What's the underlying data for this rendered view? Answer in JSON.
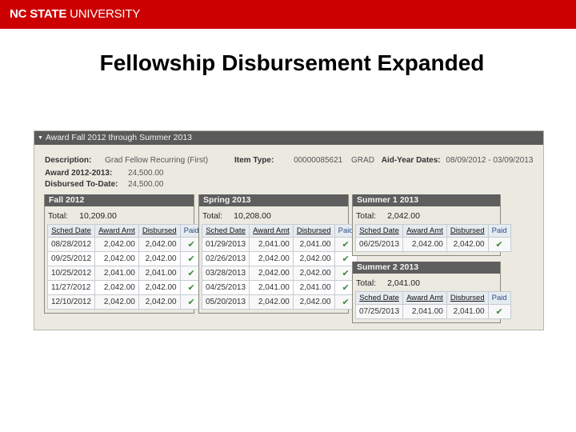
{
  "brand": {
    "bold": "NC STATE",
    "light": " UNIVERSITY",
    "color": "#cc0000"
  },
  "slide_title": "Fellowship Disbursement Expanded",
  "award": {
    "header": "Award Fall 2012 through Summer 2013",
    "description_label": "Description:",
    "description_value": "Grad Fellow Recurring (First)",
    "item_type_label": "Item Type:",
    "item_type_value": "00000085621",
    "item_type_code": "GRAD",
    "aid_year_label": "Aid-Year Dates:",
    "aid_year_value": "08/09/2012 - 03/09/2013",
    "award_label": "Award 2012-2013:",
    "award_value": "24,500.00",
    "disbursed_label": "Disbursed To-Date:",
    "disbursed_value": "24,500.00"
  },
  "columns": {
    "sched_date": "Sched Date",
    "award_amt": "Award Amt",
    "disbursed": "Disbursed",
    "paid": "Paid"
  },
  "total_label": "Total:",
  "check_glyph": "✔",
  "terms": [
    {
      "name": "Fall 2012",
      "total": "10,209.00",
      "rows": [
        {
          "date": "08/28/2012",
          "award": "2,042.00",
          "disbursed": "2,042.00",
          "paid": true
        },
        {
          "date": "09/25/2012",
          "award": "2,042.00",
          "disbursed": "2,042.00",
          "paid": true
        },
        {
          "date": "10/25/2012",
          "award": "2,041.00",
          "disbursed": "2,041.00",
          "paid": true
        },
        {
          "date": "11/27/2012",
          "award": "2,042.00",
          "disbursed": "2,042.00",
          "paid": true
        },
        {
          "date": "12/10/2012",
          "award": "2,042.00",
          "disbursed": "2,042.00",
          "paid": true
        }
      ]
    },
    {
      "name": "Spring 2013",
      "total": "10,208.00",
      "rows": [
        {
          "date": "01/29/2013",
          "award": "2,041.00",
          "disbursed": "2,041.00",
          "paid": true
        },
        {
          "date": "02/26/2013",
          "award": "2,042.00",
          "disbursed": "2,042.00",
          "paid": true
        },
        {
          "date": "03/28/2013",
          "award": "2,042.00",
          "disbursed": "2,042.00",
          "paid": true
        },
        {
          "date": "04/25/2013",
          "award": "2,041.00",
          "disbursed": "2,041.00",
          "paid": true
        },
        {
          "date": "05/20/2013",
          "award": "2,042.00",
          "disbursed": "2,042.00",
          "paid": true
        }
      ]
    },
    {
      "name": "Summer 1 2013",
      "total": "2,042.00",
      "rows": [
        {
          "date": "06/25/2013",
          "award": "2,042.00",
          "disbursed": "2,042.00",
          "paid": true
        }
      ]
    },
    {
      "name": "Summer 2 2013",
      "total": "2,041.00",
      "rows": [
        {
          "date": "07/25/2013",
          "award": "2,041.00",
          "disbursed": "2,041.00",
          "paid": true
        }
      ]
    }
  ]
}
